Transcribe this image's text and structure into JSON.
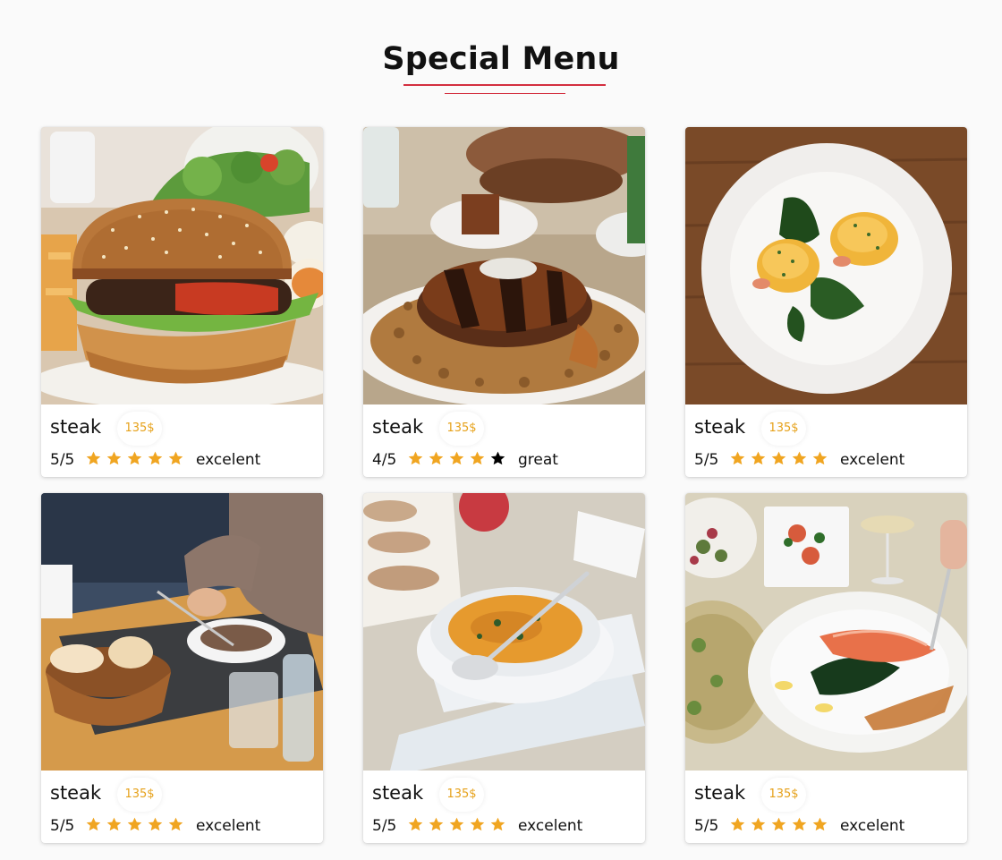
{
  "header": {
    "title": "Special Menu"
  },
  "colors": {
    "accent": "#d32f3f",
    "price": "#e6a11a",
    "star_filled": "#f0a521",
    "star_empty": "#000000"
  },
  "menu": [
    {
      "name": "steak",
      "price": "135$",
      "score": "5/5",
      "rating": 5,
      "label": "excelent",
      "image": "burger-photo"
    },
    {
      "name": "steak",
      "price": "135$",
      "score": "4/5",
      "rating": 4,
      "label": "great",
      "image": "pancake-photo"
    },
    {
      "name": "steak",
      "price": "135$",
      "score": "5/5",
      "rating": 5,
      "label": "excelent",
      "image": "eggs-benedict-photo"
    },
    {
      "name": "steak",
      "price": "135$",
      "score": "5/5",
      "rating": 5,
      "label": "excelent",
      "image": "diner-soup-photo"
    },
    {
      "name": "steak",
      "price": "135$",
      "score": "5/5",
      "rating": 5,
      "label": "excelent",
      "image": "curry-soup-photo"
    },
    {
      "name": "steak",
      "price": "135$",
      "score": "5/5",
      "rating": 5,
      "label": "excelent",
      "image": "salmon-plate-photo"
    }
  ]
}
